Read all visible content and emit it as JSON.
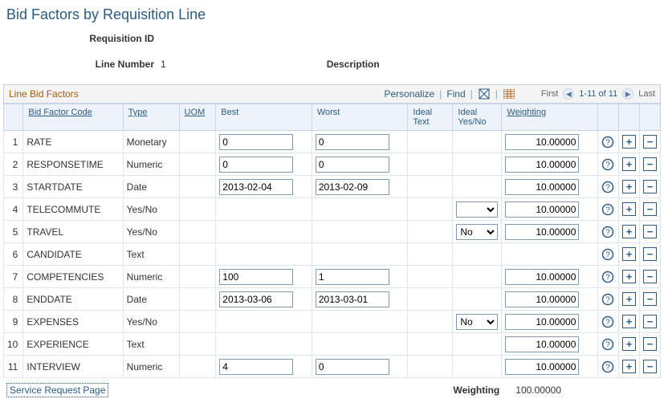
{
  "title": "Bid Factors by Requisition Line",
  "header": {
    "requisition_id_label": "Requisition ID",
    "line_number_label": "Line Number",
    "line_number_value": "1",
    "description_label": "Description"
  },
  "grid": {
    "title": "Line Bid Factors",
    "personalize": "Personalize",
    "find": "Find",
    "first": "First",
    "range": "1-11 of 11",
    "last": "Last",
    "columns": {
      "code": "Bid Factor Code",
      "type": "Type",
      "uom": "UOM",
      "best": "Best",
      "worst": "Worst",
      "ideal_text": "Ideal Text",
      "ideal_yn": "Ideal Yes/No",
      "weighting": "Weighting"
    },
    "rows": [
      {
        "n": "1",
        "code": "RATE",
        "type": "Monetary",
        "best": "0",
        "worst": "0",
        "yn_show": false,
        "yn": "",
        "text_show": false,
        "wt": "10.00000",
        "wt_show": true
      },
      {
        "n": "2",
        "code": "RESPONSETIME",
        "type": "Numeric",
        "best": "0",
        "worst": "0",
        "yn_show": false,
        "yn": "",
        "text_show": false,
        "wt": "10.00000",
        "wt_show": true
      },
      {
        "n": "3",
        "code": "STARTDATE",
        "type": "Date",
        "best": "2013-02-04",
        "worst": "2013-02-09",
        "yn_show": false,
        "yn": "",
        "text_show": false,
        "wt": "10.00000",
        "wt_show": true
      },
      {
        "n": "4",
        "code": "TELECOMMUTE",
        "type": "Yes/No",
        "best": "",
        "worst": "",
        "yn_show": true,
        "yn": "",
        "text_show": false,
        "wt": "10.00000",
        "wt_show": true
      },
      {
        "n": "5",
        "code": "TRAVEL",
        "type": "Yes/No",
        "best": "",
        "worst": "",
        "yn_show": true,
        "yn": "No",
        "text_show": false,
        "wt": "10.00000",
        "wt_show": true
      },
      {
        "n": "6",
        "code": "CANDIDATE",
        "type": "Text",
        "best": "",
        "worst": "",
        "yn_show": false,
        "yn": "",
        "text_show": false,
        "wt": "",
        "wt_show": false
      },
      {
        "n": "7",
        "code": "COMPETENCIES",
        "type": "Numeric",
        "best": "100",
        "worst": "1",
        "yn_show": false,
        "yn": "",
        "text_show": false,
        "wt": "10.00000",
        "wt_show": true
      },
      {
        "n": "8",
        "code": "ENDDATE",
        "type": "Date",
        "best": "2013-03-06",
        "worst": "2013-03-01",
        "yn_show": false,
        "yn": "",
        "text_show": false,
        "wt": "10.00000",
        "wt_show": true
      },
      {
        "n": "9",
        "code": "EXPENSES",
        "type": "Yes/No",
        "best": "",
        "worst": "",
        "yn_show": true,
        "yn": "No",
        "text_show": false,
        "wt": "10.00000",
        "wt_show": true
      },
      {
        "n": "10",
        "code": "EXPERIENCE",
        "type": "Text",
        "best": "",
        "worst": "",
        "yn_show": false,
        "yn": "",
        "text_show": false,
        "wt": "10.00000",
        "wt_show": true
      },
      {
        "n": "11",
        "code": "INTERVIEW",
        "type": "Numeric",
        "best": "4",
        "worst": "0",
        "yn_show": false,
        "yn": "",
        "text_show": false,
        "wt": "10.00000",
        "wt_show": true
      }
    ]
  },
  "footer": {
    "service_link": "Service Request Page",
    "weighting_label": "Weighting",
    "weighting_total": "100.00000"
  }
}
